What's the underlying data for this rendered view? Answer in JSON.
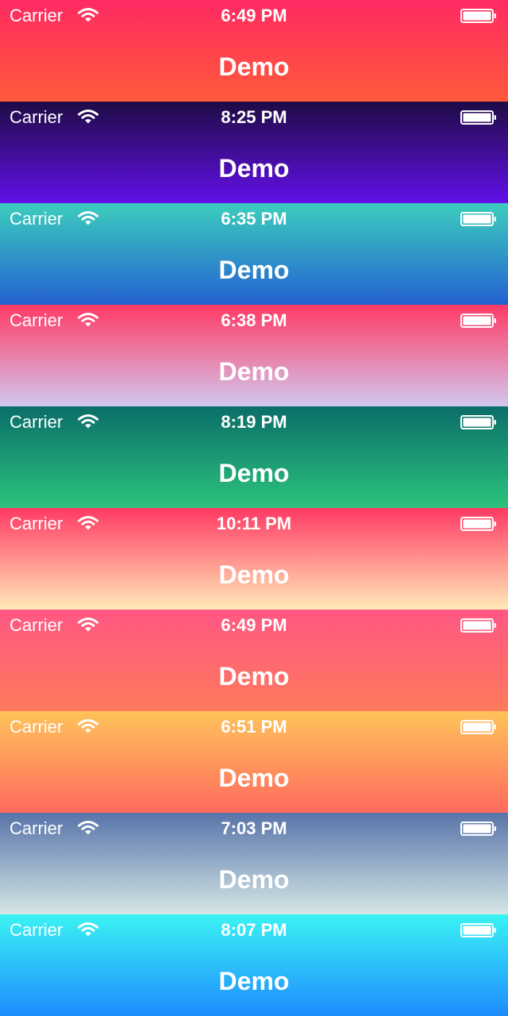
{
  "bars": [
    {
      "carrier": "Carrier",
      "time": "6:49 PM",
      "title": "Demo",
      "wifi_icon": "wifi-icon",
      "battery_icon": "battery-icon",
      "gradient": [
        "#ff2a62",
        "#ff5a3a"
      ]
    },
    {
      "carrier": "Carrier",
      "time": "8:25 PM",
      "title": "Demo",
      "wifi_icon": "wifi-icon",
      "battery_icon": "battery-icon",
      "gradient": [
        "#1f0b45",
        "#6210e8"
      ]
    },
    {
      "carrier": "Carrier",
      "time": "6:35 PM",
      "title": "Demo",
      "wifi_icon": "wifi-icon",
      "battery_icon": "battery-icon",
      "gradient": [
        "#3ccdbd",
        "#2461d2"
      ]
    },
    {
      "carrier": "Carrier",
      "time": "6:38 PM",
      "title": "Demo",
      "wifi_icon": "wifi-icon",
      "battery_icon": "battery-icon",
      "gradient": [
        "#ff3a65",
        "#d2c7ee"
      ]
    },
    {
      "carrier": "Carrier",
      "time": "8:19 PM",
      "title": "Demo",
      "wifi_icon": "wifi-icon",
      "battery_icon": "battery-icon",
      "gradient": [
        "#0b6e69",
        "#2bc37d"
      ]
    },
    {
      "carrier": "Carrier",
      "time": "10:11 PM",
      "title": "Demo",
      "wifi_icon": "wifi-icon",
      "battery_icon": "battery-icon",
      "gradient": [
        "#ff3a63",
        "#ffeab8"
      ]
    },
    {
      "carrier": "Carrier",
      "time": "6:49 PM",
      "title": "Demo",
      "wifi_icon": "wifi-icon",
      "battery_icon": "battery-icon",
      "gradient": [
        "#ff5783",
        "#ff7a5c"
      ]
    },
    {
      "carrier": "Carrier",
      "time": "6:51 PM",
      "title": "Demo",
      "wifi_icon": "wifi-icon",
      "battery_icon": "battery-icon",
      "gradient": [
        "#ffc35a",
        "#ff6a5e"
      ]
    },
    {
      "carrier": "Carrier",
      "time": "7:03 PM",
      "title": "Demo",
      "wifi_icon": "wifi-icon",
      "battery_icon": "battery-icon",
      "gradient": [
        "#5874a9",
        "#d5e7e7"
      ]
    },
    {
      "carrier": "Carrier",
      "time": "8:07 PM",
      "title": "Demo",
      "wifi_icon": "wifi-icon",
      "battery_icon": "battery-icon",
      "gradient": [
        "#3af3f3",
        "#1e8cff"
      ]
    }
  ]
}
